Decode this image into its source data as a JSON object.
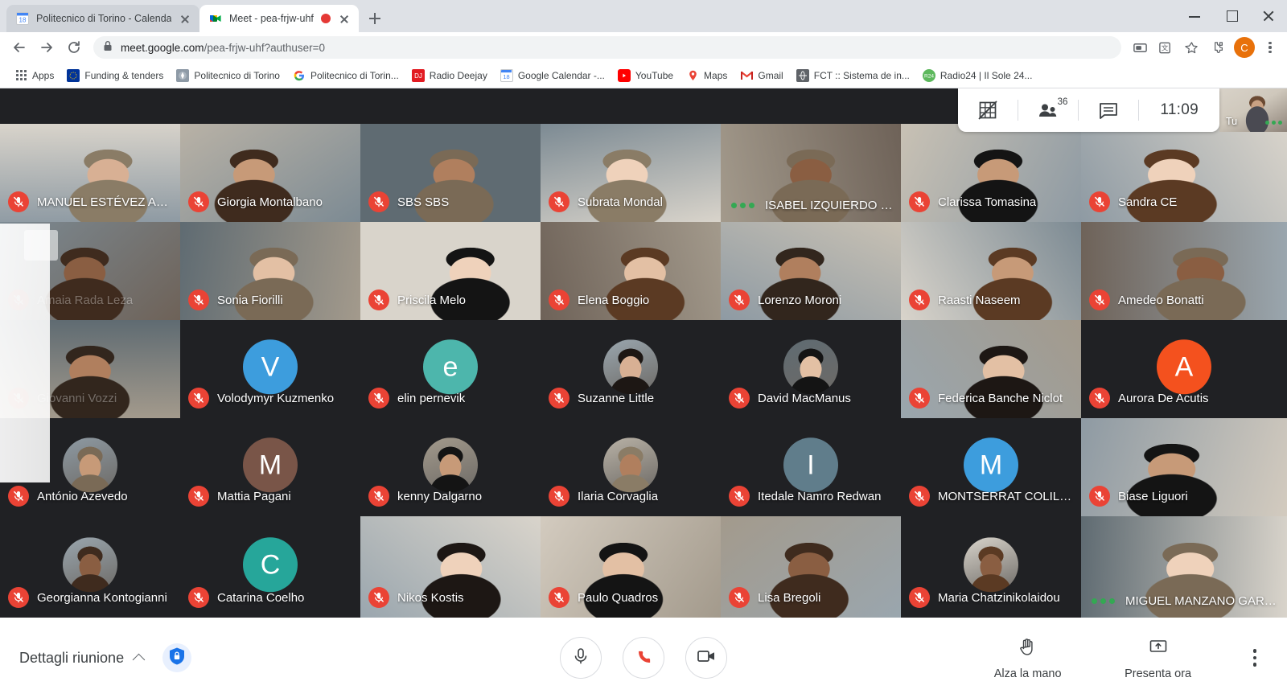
{
  "browser": {
    "tabs": [
      {
        "title": "Politecnico di Torino - Calendario",
        "favicon": "calendar-icon",
        "active": false,
        "recording": false
      },
      {
        "title": "Meet - pea-frjw-uhf",
        "favicon": "meet-icon",
        "active": true,
        "recording": true
      }
    ],
    "new_tab_label": "+",
    "window_controls": {
      "minimize": "minimize-icon",
      "maximize": "maximize-icon",
      "close": "close-icon"
    },
    "nav": {
      "back": "back-arrow-icon",
      "forward": "forward-arrow-icon",
      "reload": "reload-icon"
    },
    "omnibox": {
      "lock": "lock-icon",
      "url_bold": "meet.google.com",
      "url_dim": "/pea-frjw-uhf?authuser=0"
    },
    "toolbar_icons": [
      "cast-icon",
      "translate-icon",
      "bookmark-star-icon",
      "extensions-puzzle-icon"
    ],
    "profile_initial": "C",
    "menu": "chrome-menu-icon",
    "bookmarks": [
      {
        "label": "Apps",
        "icon": "apps-grid-icon"
      },
      {
        "label": "Funding & tenders",
        "icon": "eu-flag-icon"
      },
      {
        "label": "Politecnico di Torino",
        "icon": "polito-icon"
      },
      {
        "label": "Politecnico di Torin...",
        "icon": "google-icon"
      },
      {
        "label": "Radio Deejay",
        "icon": "radio-deejay-icon"
      },
      {
        "label": "Google Calendar -...",
        "icon": "calendar-icon"
      },
      {
        "label": "YouTube",
        "icon": "youtube-icon"
      },
      {
        "label": "Maps",
        "icon": "maps-pin-icon"
      },
      {
        "label": "Gmail",
        "icon": "gmail-icon"
      },
      {
        "label": "FCT :: Sistema de in...",
        "icon": "globe-icon"
      },
      {
        "label": "Radio24 | Il Sole 24...",
        "icon": "radio24-icon"
      }
    ]
  },
  "meet": {
    "top_overlay": {
      "layout_button": "grid-off-icon",
      "people_button": "people-icon",
      "people_count": "36",
      "chat_button": "chat-icon",
      "time": "11:09"
    },
    "self_view": {
      "label": "Tu",
      "speaking": true
    },
    "participants": [
      {
        "name": "MANUEL ESTÉVEZ AMA...",
        "muted": true,
        "speaking": false,
        "kind": "camera",
        "dimmed": false,
        "row": 0,
        "col": 0
      },
      {
        "name": "Giorgia Montalbano",
        "muted": true,
        "speaking": false,
        "kind": "camera",
        "dimmed": false,
        "row": 0,
        "col": 1
      },
      {
        "name": "SBS SBS",
        "muted": true,
        "speaking": false,
        "kind": "camera",
        "dimmed": false,
        "row": 0,
        "col": 2
      },
      {
        "name": "Subrata Mondal",
        "muted": true,
        "speaking": false,
        "kind": "camera",
        "dimmed": false,
        "row": 0,
        "col": 3
      },
      {
        "name": "ISABEL IZQUIERDO BARBA",
        "muted": false,
        "speaking": true,
        "kind": "camera",
        "dimmed": false,
        "row": 0,
        "col": 4
      },
      {
        "name": "Clarissa Tomasina",
        "muted": true,
        "speaking": false,
        "kind": "camera",
        "dimmed": false,
        "row": 0,
        "col": 5
      },
      {
        "name": "Sandra CE",
        "muted": true,
        "speaking": false,
        "kind": "camera",
        "dimmed": false,
        "row": 0,
        "col": 6
      },
      {
        "name": "Amaia Rada Leza",
        "muted": true,
        "speaking": false,
        "kind": "camera",
        "dimmed": true,
        "row": 1,
        "col": 0
      },
      {
        "name": "Sonia Fiorilli",
        "muted": true,
        "speaking": false,
        "kind": "camera",
        "dimmed": false,
        "row": 1,
        "col": 1
      },
      {
        "name": "Priscila Melo",
        "muted": true,
        "speaking": false,
        "kind": "camera",
        "dimmed": false,
        "row": 1,
        "col": 2
      },
      {
        "name": "Elena Boggio",
        "muted": true,
        "speaking": false,
        "kind": "camera",
        "dimmed": false,
        "row": 1,
        "col": 3
      },
      {
        "name": "Lorenzo Moroni",
        "muted": true,
        "speaking": false,
        "kind": "camera",
        "dimmed": false,
        "row": 1,
        "col": 4
      },
      {
        "name": "Raasti Naseem",
        "muted": true,
        "speaking": false,
        "kind": "camera",
        "dimmed": false,
        "row": 1,
        "col": 5
      },
      {
        "name": "Amedeo Bonatti",
        "muted": true,
        "speaking": false,
        "kind": "camera",
        "dimmed": false,
        "row": 1,
        "col": 6
      },
      {
        "name": "Giovanni Vozzi",
        "muted": true,
        "speaking": false,
        "kind": "camera",
        "dimmed": true,
        "row": 2,
        "col": 0
      },
      {
        "name": "Volodymyr Kuzmenko",
        "muted": true,
        "speaking": false,
        "kind": "initial",
        "initial": "V",
        "avatar_color": "#3d9ddd",
        "dimmed": false,
        "row": 2,
        "col": 1
      },
      {
        "name": "elin pernevik",
        "muted": true,
        "speaking": false,
        "kind": "initial",
        "initial": "e",
        "avatar_color": "#4db6ac",
        "dimmed": false,
        "row": 2,
        "col": 2
      },
      {
        "name": "Suzanne Little",
        "muted": true,
        "speaking": false,
        "kind": "photo",
        "dimmed": false,
        "row": 2,
        "col": 3
      },
      {
        "name": "David MacManus",
        "muted": true,
        "speaking": false,
        "kind": "photo",
        "dimmed": false,
        "row": 2,
        "col": 4
      },
      {
        "name": "Federica Banche Niclot",
        "muted": true,
        "speaking": false,
        "kind": "camera",
        "dimmed": false,
        "row": 2,
        "col": 5
      },
      {
        "name": "Aurora De Acutis",
        "muted": true,
        "speaking": false,
        "kind": "initial",
        "initial": "A",
        "avatar_color": "#f4511e",
        "dimmed": false,
        "row": 2,
        "col": 6
      },
      {
        "name": "António Azevedo",
        "muted": true,
        "speaking": false,
        "kind": "photo",
        "dimmed": false,
        "row": 3,
        "col": 0
      },
      {
        "name": "Mattia Pagani",
        "muted": true,
        "speaking": false,
        "kind": "initial",
        "initial": "M",
        "avatar_color": "#795548",
        "dimmed": false,
        "row": 3,
        "col": 1
      },
      {
        "name": "kenny Dalgarno",
        "muted": true,
        "speaking": false,
        "kind": "photo",
        "dimmed": false,
        "row": 3,
        "col": 2
      },
      {
        "name": "Ilaria Corvaglia",
        "muted": true,
        "speaking": false,
        "kind": "photo",
        "dimmed": false,
        "row": 3,
        "col": 3
      },
      {
        "name": "Itedale Namro Redwan",
        "muted": true,
        "speaking": false,
        "kind": "initial",
        "initial": "I",
        "avatar_color": "#607d8b",
        "dimmed": false,
        "row": 3,
        "col": 4
      },
      {
        "name": "MONTSERRAT COLILLA ...",
        "muted": true,
        "speaking": false,
        "kind": "initial",
        "initial": "M",
        "avatar_color": "#3d9ddd",
        "dimmed": false,
        "row": 3,
        "col": 5
      },
      {
        "name": "Biase Liguori",
        "muted": true,
        "speaking": false,
        "kind": "camera",
        "dimmed": false,
        "row": 3,
        "col": 6
      },
      {
        "name": "Georgianna Kontogianni",
        "muted": true,
        "speaking": false,
        "kind": "photo",
        "dimmed": false,
        "row": 4,
        "col": 0
      },
      {
        "name": "Catarina Coelho",
        "muted": true,
        "speaking": false,
        "kind": "initial",
        "initial": "C",
        "avatar_color": "#26a69a",
        "dimmed": false,
        "row": 4,
        "col": 1
      },
      {
        "name": "Nikos Kostis",
        "muted": true,
        "speaking": false,
        "kind": "camera",
        "dimmed": false,
        "row": 4,
        "col": 2
      },
      {
        "name": "Paulo Quadros",
        "muted": true,
        "speaking": false,
        "kind": "camera",
        "dimmed": false,
        "row": 4,
        "col": 3
      },
      {
        "name": "Lisa Bregoli",
        "muted": true,
        "speaking": false,
        "kind": "camera",
        "dimmed": false,
        "row": 4,
        "col": 4
      },
      {
        "name": "Maria Chatzinikolaidou",
        "muted": true,
        "speaking": false,
        "kind": "photo",
        "dimmed": false,
        "row": 4,
        "col": 5
      },
      {
        "name": "MIGUEL MANZANO GARL...",
        "muted": false,
        "speaking": true,
        "kind": "camera",
        "dimmed": false,
        "row": 4,
        "col": 6
      }
    ],
    "bottom_bar": {
      "details_label": "Dettagli riunione",
      "details_chevron": "chevron-up-icon",
      "security_icon": "shield-lock-icon",
      "mic_button": "microphone-icon",
      "hangup_button": "hangup-phone-icon",
      "camera_button": "video-camera-icon",
      "raise_hand_label": "Alza la mano",
      "raise_hand_icon": "raised-hand-icon",
      "present_label": "Presenta ora",
      "present_icon": "present-screen-icon",
      "more_options": "more-options-icon"
    },
    "colors": {
      "mic_red": "#ea4335",
      "speaking_green": "#34a853",
      "meet_bg": "#202124",
      "accent_blue": "#1a73e8"
    }
  }
}
